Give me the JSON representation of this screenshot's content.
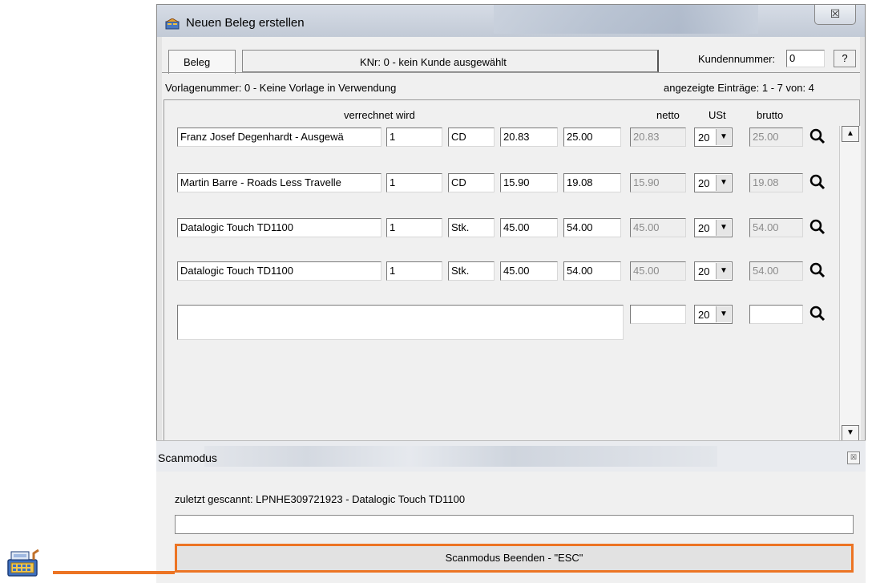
{
  "window": {
    "title": "Neuen Beleg erstellen",
    "close_glyph": "☒"
  },
  "tabs": {
    "beleg": "Beleg",
    "customer_info": "KNr: 0 - kein Kunde ausgewählt"
  },
  "customer": {
    "label": "Kundennummer:",
    "value": "0",
    "help": "?"
  },
  "info": {
    "template": "Vorlagenummer: 0 - Keine Vorlage in Verwendung",
    "entries": "angezeigte Einträge: 1 - 7 von: 4"
  },
  "headers": {
    "verrechnet": "verrechnet wird",
    "netto": "netto",
    "ust": "USt",
    "brutto": "brutto"
  },
  "rows": [
    {
      "name": "Franz Josef Degenhardt - Ausgewä",
      "qty": "1",
      "unit": "CD",
      "price_net": "20.83",
      "price_gross": "25.00",
      "netto": "20.83",
      "ust": "20",
      "brutto": "25.00"
    },
    {
      "name": "Martin Barre - Roads Less Travelle",
      "qty": "1",
      "unit": "CD",
      "price_net": "15.90",
      "price_gross": "19.08",
      "netto": "15.90",
      "ust": "20",
      "brutto": "19.08"
    },
    {
      "name": "Datalogic Touch TD1100",
      "qty": "1",
      "unit": "Stk.",
      "price_net": "45.00",
      "price_gross": "54.00",
      "netto": "45.00",
      "ust": "20",
      "brutto": "54.00"
    },
    {
      "name": "Datalogic Touch TD1100",
      "qty": "1",
      "unit": "Stk.",
      "price_net": "45.00",
      "price_gross": "54.00",
      "netto": "45.00",
      "ust": "20",
      "brutto": "54.00"
    }
  ],
  "new_row": {
    "ust": "20"
  },
  "scan": {
    "title": "Scanmodus",
    "close_glyph": "☒",
    "last_scanned": "zuletzt gescannt:  LPNHE309721923  -  Datalogic Touch TD1100",
    "end_button": "Scanmodus Beenden - \"ESC\""
  },
  "colors": {
    "accent_orange": "#ec7424"
  },
  "icons": [
    "app-icon",
    "magnifier-icon",
    "scroll-up-icon",
    "scroll-down-icon",
    "cash-register-icon"
  ]
}
